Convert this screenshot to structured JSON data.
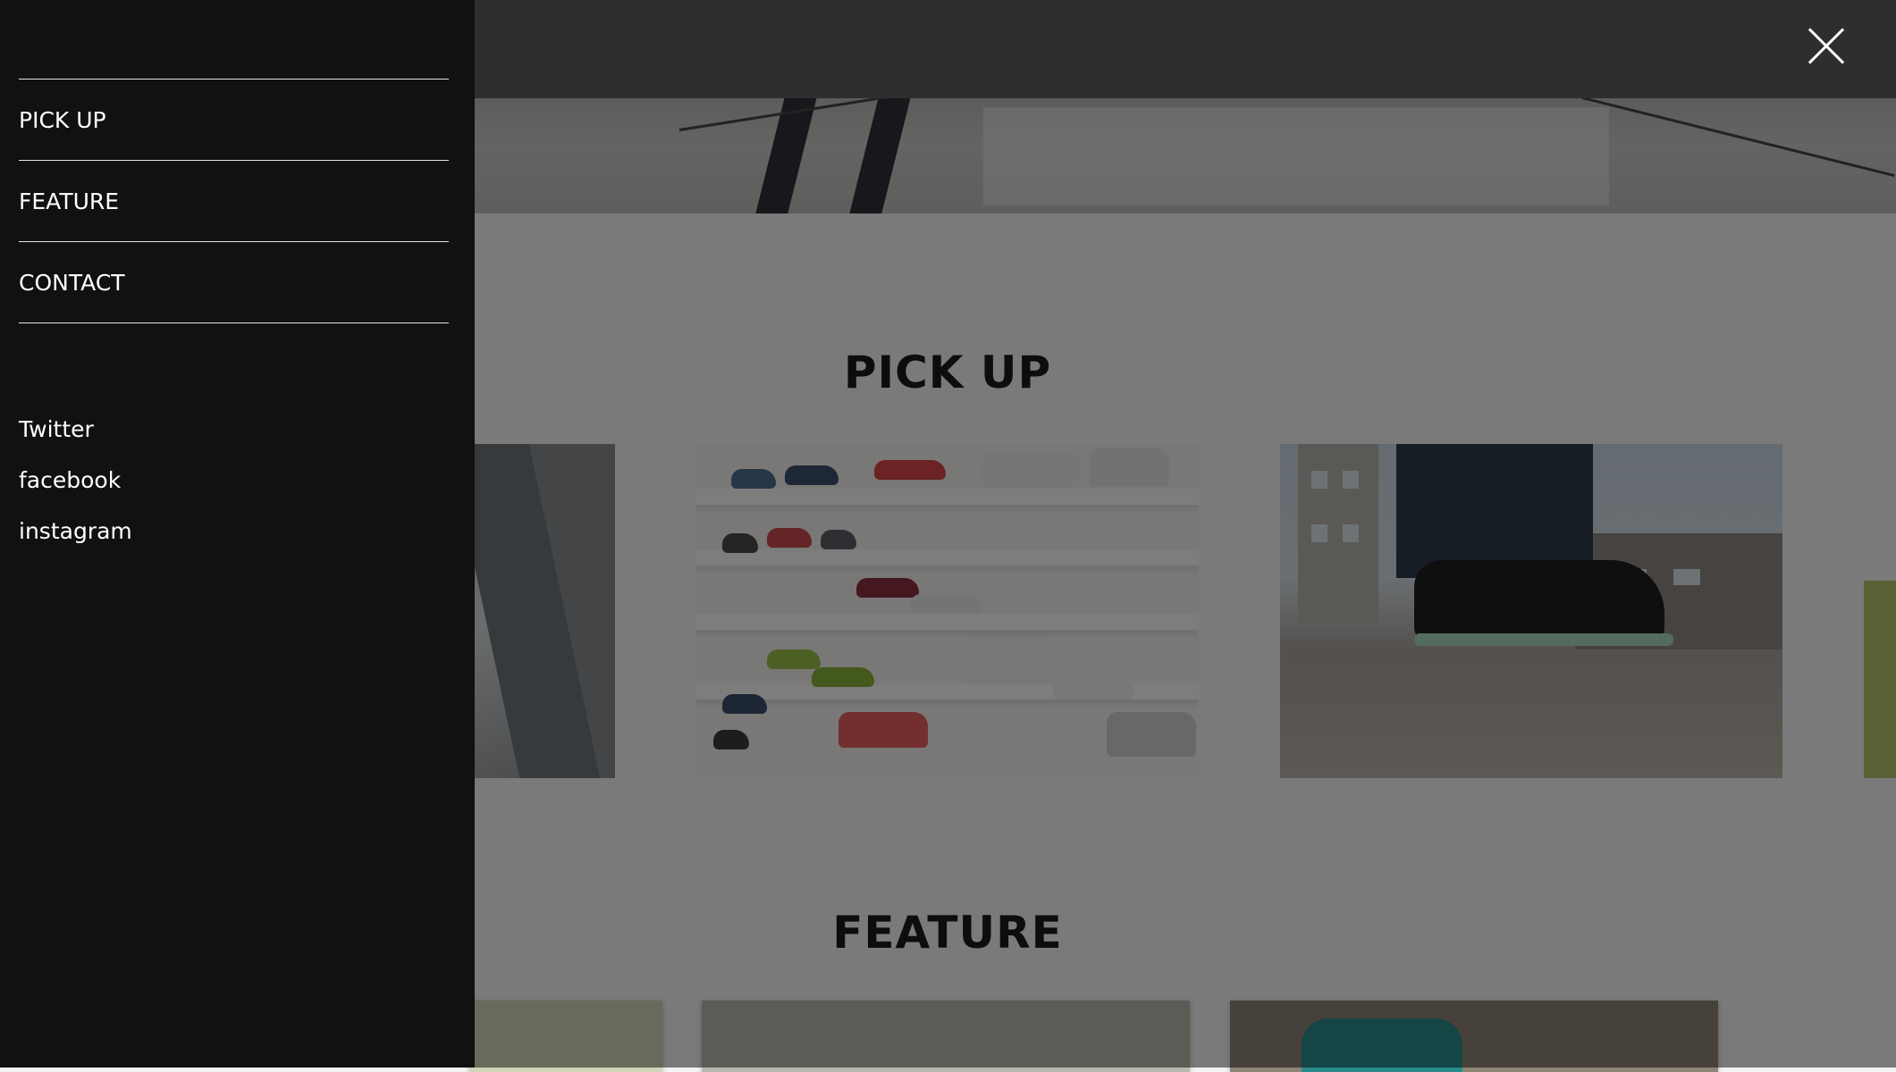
{
  "drawer": {
    "nav_items": [
      {
        "label": "PICK UP"
      },
      {
        "label": "FEATURE"
      },
      {
        "label": "CONTACT"
      }
    ],
    "social_links": [
      {
        "label": "Twitter"
      },
      {
        "label": "facebook"
      },
      {
        "label": "instagram"
      }
    ]
  },
  "main": {
    "pickup_title": "PICK UP",
    "feature_title": "FEATURE"
  },
  "icons": {
    "close": "close-icon"
  },
  "colors": {
    "drawer_bg": "#111111",
    "overlay": "rgba(0,0,0,0.5)",
    "text": "#ffffff"
  }
}
